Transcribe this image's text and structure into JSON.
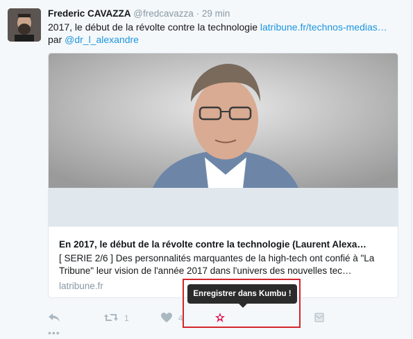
{
  "tweet": {
    "author_name": "Frederic CAVAZZA",
    "handle": "@fredcavazza",
    "separator": "·",
    "time": "29 min",
    "text_main": "2017, le début de la révolte contre la technologie ",
    "text_link": "latribune.fr/technos-medias…",
    "text_by": "par ",
    "text_mention": "@dr_l_alexandre"
  },
  "card": {
    "title": "En 2017, le début de la révolte contre la technologie (Laurent Alexa…",
    "description": "[ SERIE 2/6 ] Des personnalités marquantes de la high-tech ont confié à \"La Tribune\" leur vision de l'année 2017 dans l'univers des nouvelles tec…",
    "domain": "latribune.fr"
  },
  "actions": {
    "reply_icon": "reply-icon",
    "retweet_icon": "retweet-icon",
    "retweet_count": "1",
    "like_icon": "heart-icon",
    "like_count": "4",
    "kumbu_icon": "kumbu-icon",
    "dm_icon": "dm-icon"
  },
  "tooltip": {
    "label": "Enregistrer dans Kumbu !"
  },
  "colors": {
    "link": "#1b95e0",
    "highlight": "#d2262c",
    "kumbu": "#e0245e"
  }
}
